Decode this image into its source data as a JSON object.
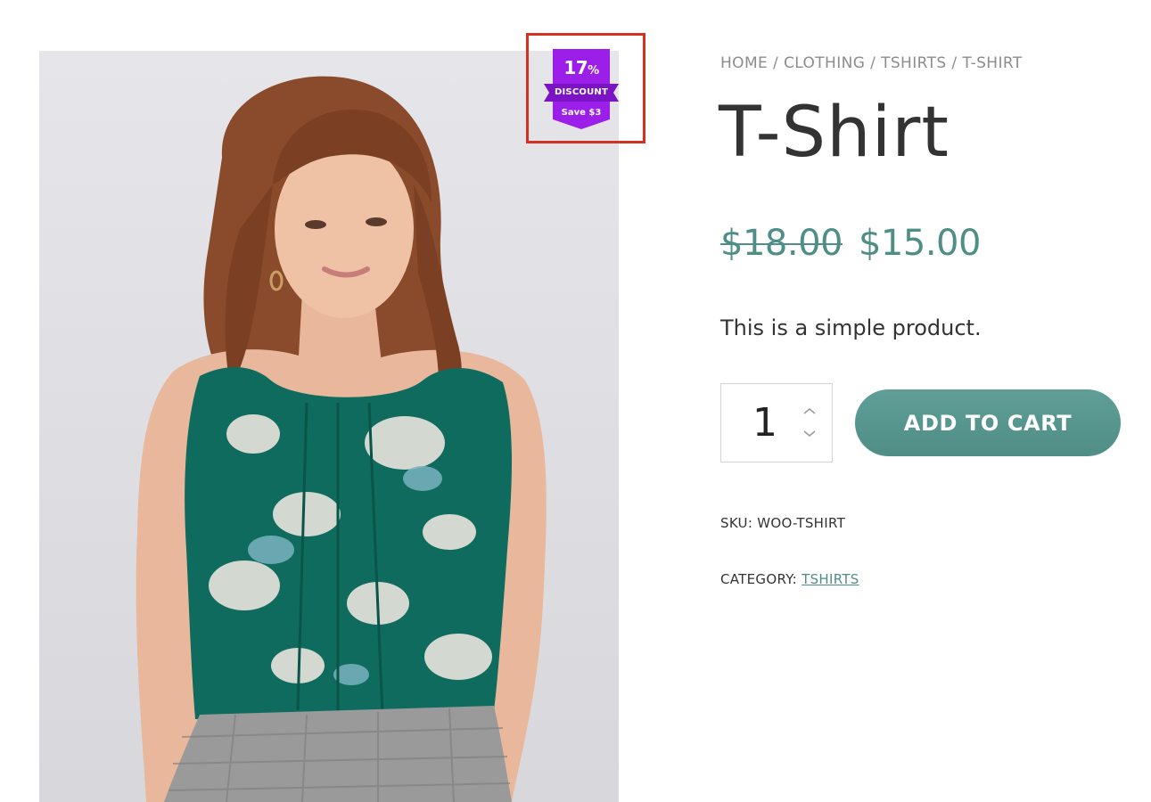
{
  "product": {
    "breadcrumb": [
      {
        "label": "HOME"
      },
      {
        "label": "CLOTHING"
      },
      {
        "label": "TSHIRTS"
      },
      {
        "label": "T-SHIRT"
      }
    ],
    "breadcrumb_separator": " / ",
    "title": "T-Shirt",
    "price_regular": "$18.00",
    "price_sale": "$15.00",
    "short_description": "This is a simple product.",
    "quantity": "1",
    "add_to_cart_label": "ADD TO CART",
    "sku_label": "SKU:",
    "sku_value": "WOO-TSHIRT",
    "category_label": "CATEGORY:",
    "category_value": "TSHIRTS"
  },
  "badge": {
    "percent": "17",
    "percent_sign": "%",
    "label": "DISCOUNT",
    "save_text": "Save $3",
    "color": "#9b1fe8",
    "ribbon_color": "#7a14c4"
  },
  "colors": {
    "accent": "#4f8e87",
    "highlight_box": "#d6301e",
    "text": "#333333",
    "muted": "#8c8c8c"
  },
  "icons": {
    "qty_up": "chevron-up-icon",
    "qty_down": "chevron-down-icon"
  }
}
